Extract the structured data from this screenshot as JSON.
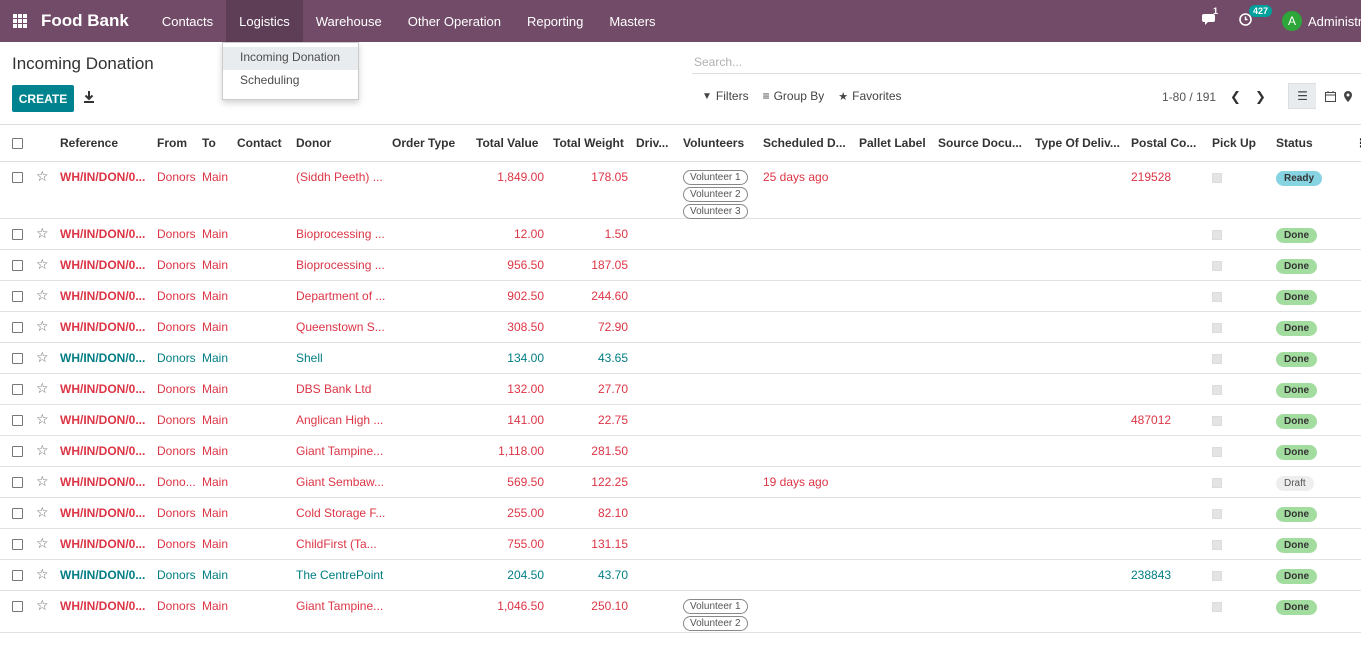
{
  "nav": {
    "brand": "Food Bank",
    "menus": [
      "Contacts",
      "Logistics",
      "Warehouse",
      "Other Operation",
      "Reporting",
      "Masters"
    ],
    "active_menu": "Logistics",
    "messages_count": "1",
    "activities_count": "427",
    "user_initial": "A",
    "user_name": "Administrat"
  },
  "dropdown": {
    "items": [
      "Incoming Donation",
      "Scheduling"
    ]
  },
  "control": {
    "title": "Incoming Donation",
    "create_label": "CREATE",
    "search_placeholder": "Search...",
    "filters_label": "Filters",
    "group_by_label": "Group By",
    "favorites_label": "Favorites",
    "pager": "1-80 / 191"
  },
  "table": {
    "columns": [
      "Reference",
      "From",
      "To",
      "Contact",
      "Donor",
      "Order Type",
      "Total Value",
      "Total Weight",
      "Driv...",
      "Volunteers",
      "Scheduled D...",
      "Pallet Label",
      "Source Docu...",
      "Type Of Deliv...",
      "Postal Co...",
      "Pick Up",
      "Status"
    ],
    "rows": [
      {
        "ref": "WH/IN/DON/0...",
        "from": "Donors",
        "to": "Main",
        "donor": "(Siddh Peeth) ...",
        "value": "1,849.00",
        "weight": "178.05",
        "volunteers": [
          "Volunteer 1",
          "Volunteer 2",
          "Volunteer 3"
        ],
        "scheduled": "25 days ago",
        "postal": "219528",
        "status": "Ready",
        "color": "red"
      },
      {
        "ref": "WH/IN/DON/0...",
        "from": "Donors",
        "to": "Main",
        "donor": "Bioprocessing ...",
        "value": "12.00",
        "weight": "1.50",
        "volunteers": [],
        "scheduled": "",
        "postal": "",
        "status": "Done",
        "color": "red"
      },
      {
        "ref": "WH/IN/DON/0...",
        "from": "Donors",
        "to": "Main",
        "donor": "Bioprocessing ...",
        "value": "956.50",
        "weight": "187.05",
        "volunteers": [],
        "scheduled": "",
        "postal": "",
        "status": "Done",
        "color": "red"
      },
      {
        "ref": "WH/IN/DON/0...",
        "from": "Donors",
        "to": "Main",
        "donor": "Department of ...",
        "value": "902.50",
        "weight": "244.60",
        "volunteers": [],
        "scheduled": "",
        "postal": "",
        "status": "Done",
        "color": "red"
      },
      {
        "ref": "WH/IN/DON/0...",
        "from": "Donors",
        "to": "Main",
        "donor": "Queenstown S...",
        "value": "308.50",
        "weight": "72.90",
        "volunteers": [],
        "scheduled": "",
        "postal": "",
        "status": "Done",
        "color": "red"
      },
      {
        "ref": "WH/IN/DON/0...",
        "from": "Donors",
        "to": "Main",
        "donor": "Shell",
        "value": "134.00",
        "weight": "43.65",
        "volunteers": [],
        "scheduled": "",
        "postal": "",
        "status": "Done",
        "color": "blue"
      },
      {
        "ref": "WH/IN/DON/0...",
        "from": "Donors",
        "to": "Main",
        "donor": "DBS Bank Ltd",
        "value": "132.00",
        "weight": "27.70",
        "volunteers": [],
        "scheduled": "",
        "postal": "",
        "status": "Done",
        "color": "red"
      },
      {
        "ref": "WH/IN/DON/0...",
        "from": "Donors",
        "to": "Main",
        "donor": "Anglican High ...",
        "value": "141.00",
        "weight": "22.75",
        "volunteers": [],
        "scheduled": "",
        "postal": "487012",
        "status": "Done",
        "color": "red"
      },
      {
        "ref": "WH/IN/DON/0...",
        "from": "Donors",
        "to": "Main",
        "donor": "Giant Tampine...",
        "value": "1,118.00",
        "weight": "281.50",
        "volunteers": [],
        "scheduled": "",
        "postal": "",
        "status": "Done",
        "color": "red"
      },
      {
        "ref": "WH/IN/DON/0...",
        "from": "Dono...",
        "to": "Main",
        "donor": "Giant Sembaw...",
        "value": "569.50",
        "weight": "122.25",
        "volunteers": [],
        "scheduled": "19 days ago",
        "postal": "",
        "status": "Draft",
        "color": "red"
      },
      {
        "ref": "WH/IN/DON/0...",
        "from": "Donors",
        "to": "Main",
        "donor": "Cold Storage F...",
        "value": "255.00",
        "weight": "82.10",
        "volunteers": [],
        "scheduled": "",
        "postal": "",
        "status": "Done",
        "color": "red"
      },
      {
        "ref": "WH/IN/DON/0...",
        "from": "Donors",
        "to": "Main",
        "donor": "ChildFirst (Ta...",
        "value": "755.00",
        "weight": "131.15",
        "volunteers": [],
        "scheduled": "",
        "postal": "",
        "status": "Done",
        "color": "red"
      },
      {
        "ref": "WH/IN/DON/0...",
        "from": "Donors",
        "to": "Main",
        "donor": "The CentrePoint",
        "value": "204.50",
        "weight": "43.70",
        "volunteers": [],
        "scheduled": "",
        "postal": "238843",
        "status": "Done",
        "color": "blue"
      },
      {
        "ref": "WH/IN/DON/0...",
        "from": "Donors",
        "to": "Main",
        "donor": "Giant Tampine...",
        "value": "1,046.50",
        "weight": "250.10",
        "volunteers": [
          "Volunteer 1",
          "Volunteer 2"
        ],
        "scheduled": "",
        "postal": "",
        "status": "Done",
        "color": "red"
      }
    ]
  }
}
